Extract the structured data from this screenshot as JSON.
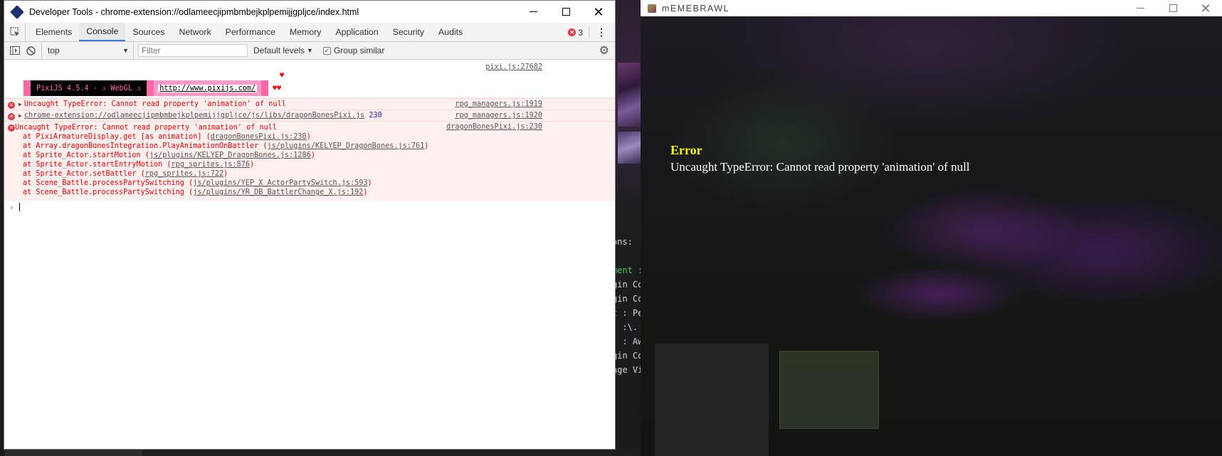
{
  "devtools": {
    "window_title": "Developer Tools - chrome-extension://odlameecjipmbmbejkplpemijjgpljce/index.html",
    "tabs": [
      {
        "label": "Elements"
      },
      {
        "label": "Console"
      },
      {
        "label": "Sources"
      },
      {
        "label": "Network"
      },
      {
        "label": "Performance"
      },
      {
        "label": "Memory"
      },
      {
        "label": "Application"
      },
      {
        "label": "Security"
      },
      {
        "label": "Audits"
      }
    ],
    "active_tab": "Console",
    "error_count": "3",
    "toolbar": {
      "context": "top",
      "filter_placeholder": "Filter",
      "levels": "Default levels",
      "group_similar": "Group similar",
      "group_similar_checked": true
    },
    "console": {
      "pixi": {
        "source": "pixi.js:27682",
        "banner_text": "PixiJS 4.5.4 - ✰ WebGL ✰",
        "link": "http://www.pixijs.com/",
        "hearts_small": "♥♥",
        "heart_big": "♥"
      },
      "errors": [
        {
          "message": "Uncaught TypeError: Cannot read property 'animation' of null",
          "source": "rpg_managers.js:1919"
        },
        {
          "link": "chrome-extension://odlameecjipmbmbejkplpemijjgpljce/js/libs/dragonBonesPixi.js",
          "line": "230",
          "source": "rpg_managers.js:1920"
        },
        {
          "message": "Uncaught TypeError: Cannot read property 'animation' of null",
          "source": "dragonBonesPixi.js:230",
          "stack": [
            {
              "prefix": "at PixiArmatureDisplay.get [as animation] (",
              "link": "dragonBonesPixi.js:230",
              "suffix": ")"
            },
            {
              "prefix": "at Array.dragonBonesIntegration.PlayAnimationOnBattler (",
              "link": "js/plugins/KELYEP_DragonBones.js:761",
              "suffix": ")"
            },
            {
              "prefix": "at Sprite_Actor.startMotion (",
              "link": "js/plugins/KELYEP_DragonBones.js:1286",
              "suffix": ")"
            },
            {
              "prefix": "at Sprite_Actor.startEntryMotion (",
              "link": "rpg_sprites.js:876",
              "suffix": ")"
            },
            {
              "prefix": "at Sprite_Actor.setBattler (",
              "link": "rpg_sprites.js:722",
              "suffix": ")"
            },
            {
              "prefix": "at Scene_Battle.processPartySwitching (",
              "link": "js/plugins/YEP_X_ActorPartySwitch.js:593",
              "suffix": ")"
            },
            {
              "prefix": "at Scene_Battle.processPartySwitching (",
              "link": "js/plugins/YR_DB_BattlerChange_X.js:192",
              "suffix": ")"
            }
          ]
        }
      ],
      "prompt": ">"
    }
  },
  "game": {
    "window_title": "mEMEBRAWL",
    "error_title": "Error",
    "error_message": "Uncaught TypeError: Cannot read property 'animation' of null"
  },
  "background": {
    "code_lines": [
      {
        "text": "ons:",
        "green": false
      },
      {
        "text": "",
        "green": false
      },
      {
        "text": "ment :",
        "green": true
      },
      {
        "text": "gin Co",
        "green": false
      },
      {
        "text": "gin Co",
        "green": false
      },
      {
        "text": "t : Pe",
        "green": false
      },
      {
        "text": "  :\\.",
        "green": false
      },
      {
        "text": "  : Aw",
        "green": false
      },
      {
        "text": "gin Co",
        "green": false
      },
      {
        "text": "nge Vi",
        "green": false
      }
    ]
  },
  "colors": {
    "error_red": "#ff0000",
    "error_bg": "#fff0f0",
    "tab_active": "#3879d9",
    "pixi_pink": "#ff66a5",
    "game_error_title": "#ffff00"
  }
}
